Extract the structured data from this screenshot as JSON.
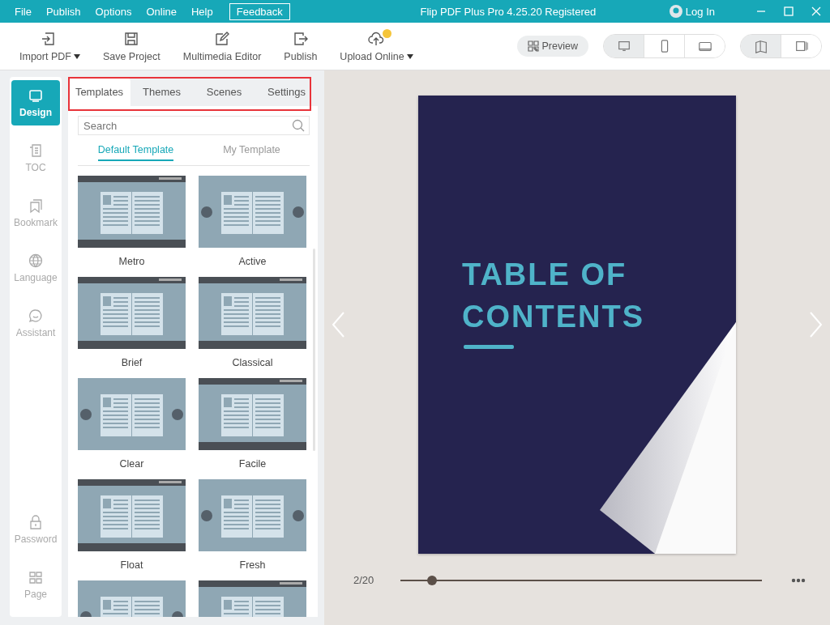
{
  "menu": [
    {
      "label": "File"
    },
    {
      "label": "Publish"
    },
    {
      "label": "Options"
    },
    {
      "label": "Online"
    },
    {
      "label": "Help"
    }
  ],
  "feedback_button": "Feedback",
  "window": {
    "title": "Flip PDF Plus Pro 4.25.20 Registered",
    "login": "Log In"
  },
  "toolbar": [
    {
      "label": "Import PDF",
      "dropdown": true,
      "badge": false
    },
    {
      "label": "Save Project",
      "dropdown": false,
      "badge": false
    },
    {
      "label": "Multimedia Editor",
      "dropdown": false,
      "badge": false
    },
    {
      "label": "Publish",
      "dropdown": false,
      "badge": false
    },
    {
      "label": "Upload Online",
      "dropdown": true,
      "badge": true
    }
  ],
  "preview_button": "Preview",
  "devices": [
    {
      "selected": true
    },
    {
      "selected": false
    },
    {
      "selected": false
    }
  ],
  "view_modes": [
    {
      "selected": true
    },
    {
      "selected": false
    }
  ],
  "sidebar": {
    "items": [
      {
        "label": "Design",
        "selected": true
      },
      {
        "label": "TOC",
        "selected": false
      },
      {
        "label": "Bookmark",
        "selected": false
      },
      {
        "label": "Language",
        "selected": false
      },
      {
        "label": "Assistant",
        "selected": false
      }
    ],
    "bottom_items": [
      {
        "label": "Password",
        "selected": false
      },
      {
        "label": "Page",
        "selected": false
      }
    ]
  },
  "tabs": [
    {
      "label": "Templates",
      "selected": true
    },
    {
      "label": "Themes",
      "selected": false
    },
    {
      "label": "Scenes",
      "selected": false
    },
    {
      "label": "Settings",
      "selected": false
    }
  ],
  "search": {
    "placeholder": "Search"
  },
  "subtabs": [
    {
      "label": "Default Template",
      "selected": true
    },
    {
      "label": "My Template",
      "selected": false
    }
  ],
  "templates": [
    {
      "name": "Metro",
      "kind": "bars"
    },
    {
      "name": "Active",
      "kind": "plain"
    },
    {
      "name": "Brief",
      "kind": "bars"
    },
    {
      "name": "Classical",
      "kind": "bars"
    },
    {
      "name": "Clear",
      "kind": "plain"
    },
    {
      "name": "Facile",
      "kind": "bars"
    },
    {
      "name": "Float",
      "kind": "bars"
    },
    {
      "name": "Fresh",
      "kind": "plain"
    },
    {
      "kind": "plain"
    },
    {
      "kind": "bars"
    }
  ],
  "book": {
    "cover_title": "TABLE OF CONTENTS",
    "page_counter": "2/20",
    "slider": {
      "level": 0.087
    }
  }
}
